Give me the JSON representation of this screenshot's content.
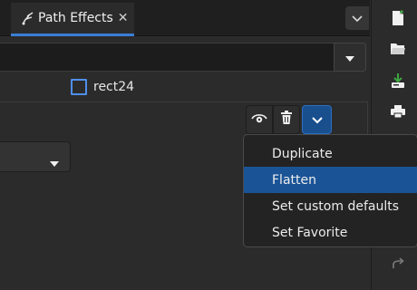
{
  "tab": {
    "icon": "path-effects-icon",
    "label": "Path Effects",
    "close_glyph": "✕"
  },
  "object": {
    "label": "rect24",
    "icon": "rect-object-icon"
  },
  "effect_controls": {
    "visibility_icon": "eye-icon",
    "delete_icon": "trash-icon",
    "menu_icon": "chevron-down-icon"
  },
  "menu": {
    "items": [
      {
        "label": "Duplicate",
        "active": false
      },
      {
        "label": "Flatten",
        "active": true
      },
      {
        "label": "Set custom defaults",
        "active": false
      },
      {
        "label": "Set Favorite",
        "active": false
      }
    ]
  },
  "toolbar": {
    "icons": [
      "new-document-icon",
      "open-folder-icon",
      "save-icon",
      "print-icon",
      "redo-icon"
    ]
  },
  "colors": {
    "accent": "#3a7dd8",
    "menu_highlight": "#1a5497",
    "object_outline": "#4f8fea",
    "save_arrow": "#3fa640"
  }
}
